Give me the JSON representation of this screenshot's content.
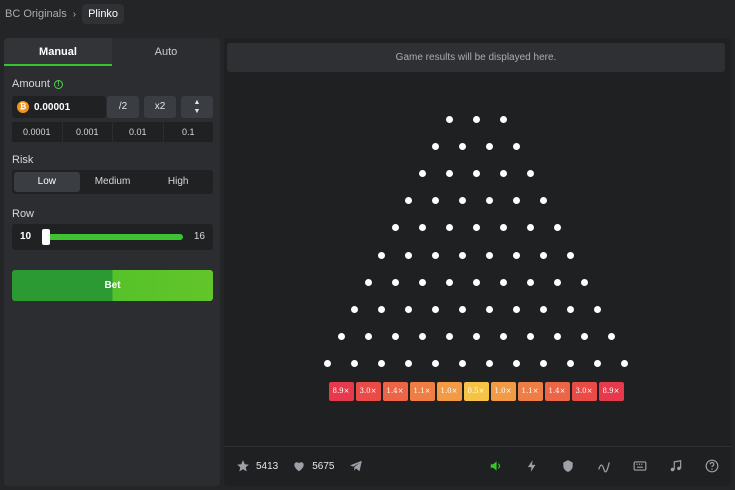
{
  "breadcrumb": {
    "root": "BC Originals",
    "current": "Plinko"
  },
  "tabs": [
    {
      "label": "Manual",
      "active": true
    },
    {
      "label": "Auto",
      "active": false
    }
  ],
  "amount": {
    "label": "Amount",
    "currency_icon": "bitcoin-icon",
    "value": "0.00001",
    "half_label": "/2",
    "double_label": "x2",
    "presets": [
      "0.0001",
      "0.001",
      "0.01",
      "0.1"
    ]
  },
  "risk": {
    "label": "Risk",
    "options": [
      "Low",
      "Medium",
      "High"
    ],
    "selected": "Low"
  },
  "row": {
    "label": "Row",
    "min": "10",
    "max": "16",
    "value": 10
  },
  "bet_label": "Bet",
  "results_placeholder": "Game results will be displayed here.",
  "board": {
    "rows": 10,
    "multipliers": [
      "8.9×",
      "3.0×",
      "1.4×",
      "1.1×",
      "1.0×",
      "0.5×",
      "1.0×",
      "1.1×",
      "1.4×",
      "3.0×",
      "8.9×"
    ],
    "multiplier_colors": [
      "#e8394c",
      "#ea4b47",
      "#ec6546",
      "#ef7e45",
      "#f29b44",
      "#f6c444",
      "#f29b44",
      "#ef7e45",
      "#ec6546",
      "#ea4b47",
      "#e8394c"
    ]
  },
  "footer": {
    "stars": "5413",
    "likes": "5675",
    "icons": [
      "star-icon",
      "heart-icon",
      "telegram-icon",
      "volume-icon",
      "lightning-icon",
      "fairness-icon",
      "chart-line-icon",
      "keyboard-icon",
      "music-icon",
      "help-icon"
    ],
    "accent": "#36c52b"
  }
}
